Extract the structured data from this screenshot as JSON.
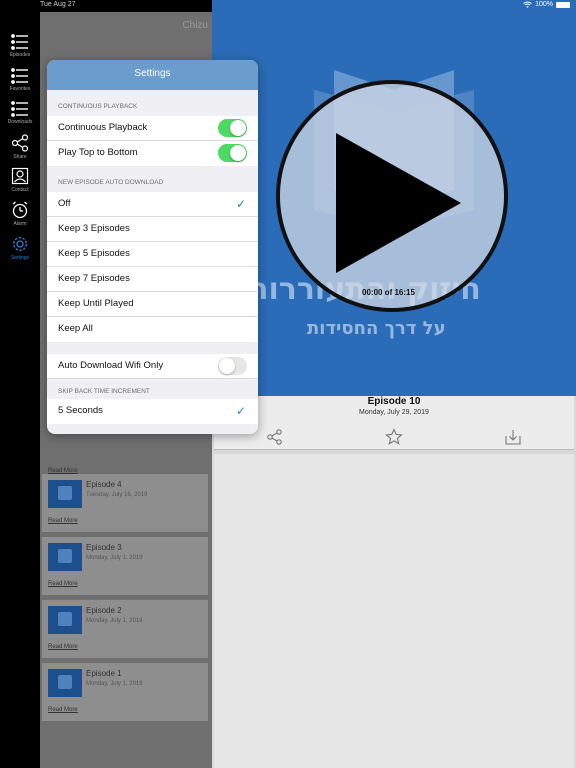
{
  "status_bar": {
    "time": "Tue Aug 27",
    "battery": "100%"
  },
  "tabs": [
    {
      "label": "Episodes"
    },
    {
      "label": "Favorites"
    },
    {
      "label": "Downloads"
    },
    {
      "label": "Share"
    },
    {
      "label": "Contact"
    },
    {
      "label": "Alarm"
    },
    {
      "label": "Settings"
    }
  ],
  "list": {
    "title": "Chizu",
    "read_more": "Read More",
    "episodes": [
      {
        "title": "Episode 4",
        "date": "Tuesday, July 16, 2019",
        "read_more": "Read More"
      },
      {
        "title": "Episode 3",
        "date": "Monday, July 1, 2019",
        "read_more": "Read More"
      },
      {
        "title": "Episode 2",
        "date": "Monday, July 1, 2019",
        "read_more": "Read More"
      },
      {
        "title": "Episode 1",
        "date": "Monday, July 1, 2019",
        "read_more": "Read More"
      }
    ]
  },
  "player": {
    "artwork_title": "חיזוק והתעוררות",
    "artwork_subtitle": "על דרך החסידות",
    "time": "00:00 of 16:15",
    "episode_title": "Episode 10",
    "episode_date": "Monday, July 29, 2019"
  },
  "settings": {
    "title": "Settings",
    "continuous_header": "CONTINUOUS PLAYBACK",
    "continuous_playback": {
      "label": "Continuous Playback",
      "on": true
    },
    "play_top_to_bottom": {
      "label": "Play Top to Bottom",
      "on": true
    },
    "auto_download_header": "NEW EPISODE AUTO DOWNLOAD",
    "auto_download_options": [
      {
        "label": "Off",
        "selected": true
      },
      {
        "label": "Keep 3 Episodes",
        "selected": false
      },
      {
        "label": "Keep 5 Episodes",
        "selected": false
      },
      {
        "label": "Keep 7 Episodes",
        "selected": false
      },
      {
        "label": "Keep Until Played",
        "selected": false
      },
      {
        "label": "Keep All",
        "selected": false
      }
    ],
    "wifi_only": {
      "label": "Auto Download Wifi Only",
      "on": false
    },
    "skip_back_header": "SKIP BACK TIME INCREMENT",
    "skip_back_selected": {
      "label": "5 Seconds",
      "selected": true
    }
  },
  "colors": {
    "accent": "#2e7fd9",
    "toggle_on": "#4cd964",
    "header": "#6a9ccd",
    "artwork_bg": "#2a6cb7"
  }
}
